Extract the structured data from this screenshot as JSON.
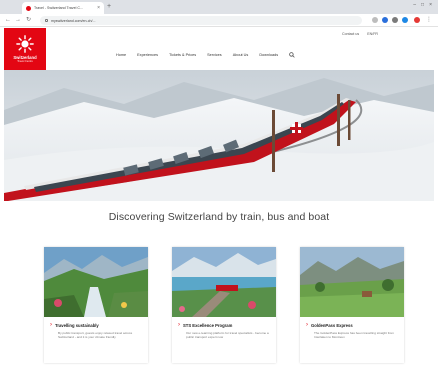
{
  "browser": {
    "tab_title": "Travel - Switzerland Travel C...",
    "tab_close": "×",
    "new_tab": "+",
    "url": "myswitzerland.com/en-ch/...",
    "nav": {
      "back": "←",
      "forward": "→",
      "reload": "↻"
    },
    "window_controls": {
      "minimize": "–",
      "maximize": "□",
      "close": "×"
    }
  },
  "header": {
    "logo": {
      "text": "Switzerland",
      "sub": "Travel Centre"
    },
    "utility": [
      "Contact us",
      "EN/FR"
    ],
    "nav": [
      "Home",
      "Experiences",
      "Tickets & Prices",
      "Services",
      "About Us",
      "Downloads"
    ],
    "search_icon": "search-icon"
  },
  "headline": "Discovering Switzerland by train, bus and boat",
  "cards": [
    {
      "title": "Travelling sustainably",
      "text": "By public transport, guests enjoy relaxed travel across Switzerland - and it is your climate friendly"
    },
    {
      "title": "STS Excellence Program",
      "text": "Our new e-learning platform for travel specialists - become a public transport expert now"
    },
    {
      "title": "GoldenPass Express",
      "text": "The GoldenPass Express has been travelling straight from Interlaken to Montreux"
    }
  ],
  "colors": {
    "brand_red": "#e30613",
    "chrome_bg": "#dee1e6",
    "text_gray": "#444444"
  }
}
